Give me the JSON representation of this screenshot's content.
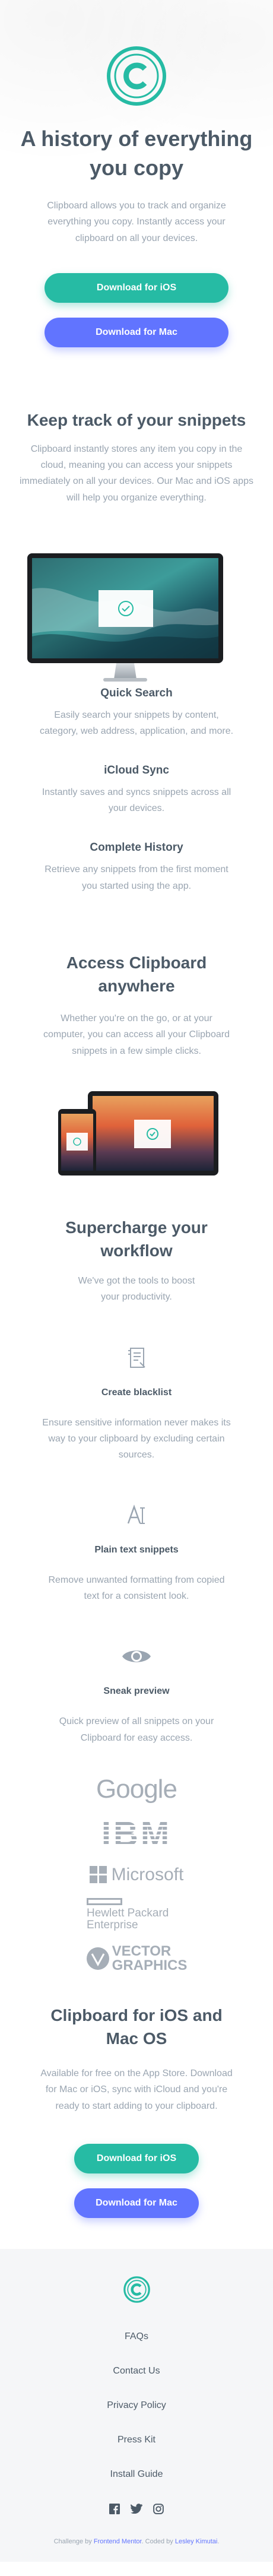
{
  "colors": {
    "accent_green": "#26BBA4",
    "accent_blue": "#6174FF",
    "heading": "#4C5A67",
    "muted": "#9AA5B1",
    "footer_bg": "#F5F6F8"
  },
  "hero": {
    "logo_icon": "clipboard-c-logo",
    "title": "A history of everything you copy",
    "description": "Clipboard allows you to track and organize everything you copy. Instantly access your clipboard on all your devices.",
    "ios_button": "Download for iOS",
    "mac_button": "Download for Mac"
  },
  "snippets": {
    "title": "Keep track of your snippets",
    "description": "Clipboard instantly stores any item you copy in the cloud, meaning you can access your snippets immediately on all your devices. Our Mac and iOS apps will help you organize everything.",
    "features": [
      {
        "title": "Quick Search",
        "description": "Easily search your snippets by content, category, web address, application, and more."
      },
      {
        "title": "iCloud Sync",
        "description": "Instantly saves and syncs snippets across all your devices."
      },
      {
        "title": "Complete History",
        "description": "Retrieve any snippets from the first moment you started using the app."
      }
    ]
  },
  "access": {
    "title": "Access Clipboard anywhere",
    "description": "Whether you're on the go, or at your computer, you can access all your Clipboard snippets in a few simple clicks."
  },
  "supercharge": {
    "title": "Supercharge your workflow",
    "description": "We've got the tools to boost your productivity.",
    "tools": [
      {
        "icon": "blacklist-icon",
        "title": "Create blacklist",
        "description": "Ensure sensitive information never makes its way to your clipboard by excluding certain sources."
      },
      {
        "icon": "text-icon",
        "title": "Plain text snippets",
        "description": "Remove unwanted formatting from copied text for a consistent look."
      },
      {
        "icon": "eye-icon",
        "title": "Sneak preview",
        "description": "Quick preview of all snippets on your Clipboard for easy access."
      }
    ]
  },
  "logos": {
    "google": "Google",
    "ibm": "IBM",
    "microsoft": "Microsoft",
    "hp_line1": "Hewlett Packard",
    "hp_line2": "Enterprise",
    "vector_line1": "VECTOR",
    "vector_line2": "GRAPHICS"
  },
  "cta": {
    "title": "Clipboard for iOS and Mac OS",
    "description": "Available for free on the App Store. Download for Mac or iOS, sync with iCloud and you're ready to start adding to your clipboard.",
    "ios_button": "Download for iOS",
    "mac_button": "Download for Mac"
  },
  "footer": {
    "logo_icon": "clipboard-c-logo",
    "links": [
      "FAQs",
      "Contact Us",
      "Privacy Policy",
      "Press Kit",
      "Install Guide"
    ],
    "social_icons": [
      "facebook-icon",
      "twitter-icon",
      "instagram-icon"
    ],
    "attribution_prefix": "Challenge by",
    "attribution_challenge": "Frontend Mentor",
    "attribution_middle": ". Coded by",
    "attribution_author": "Lesley Kimutai",
    "attribution_suffix": "."
  }
}
